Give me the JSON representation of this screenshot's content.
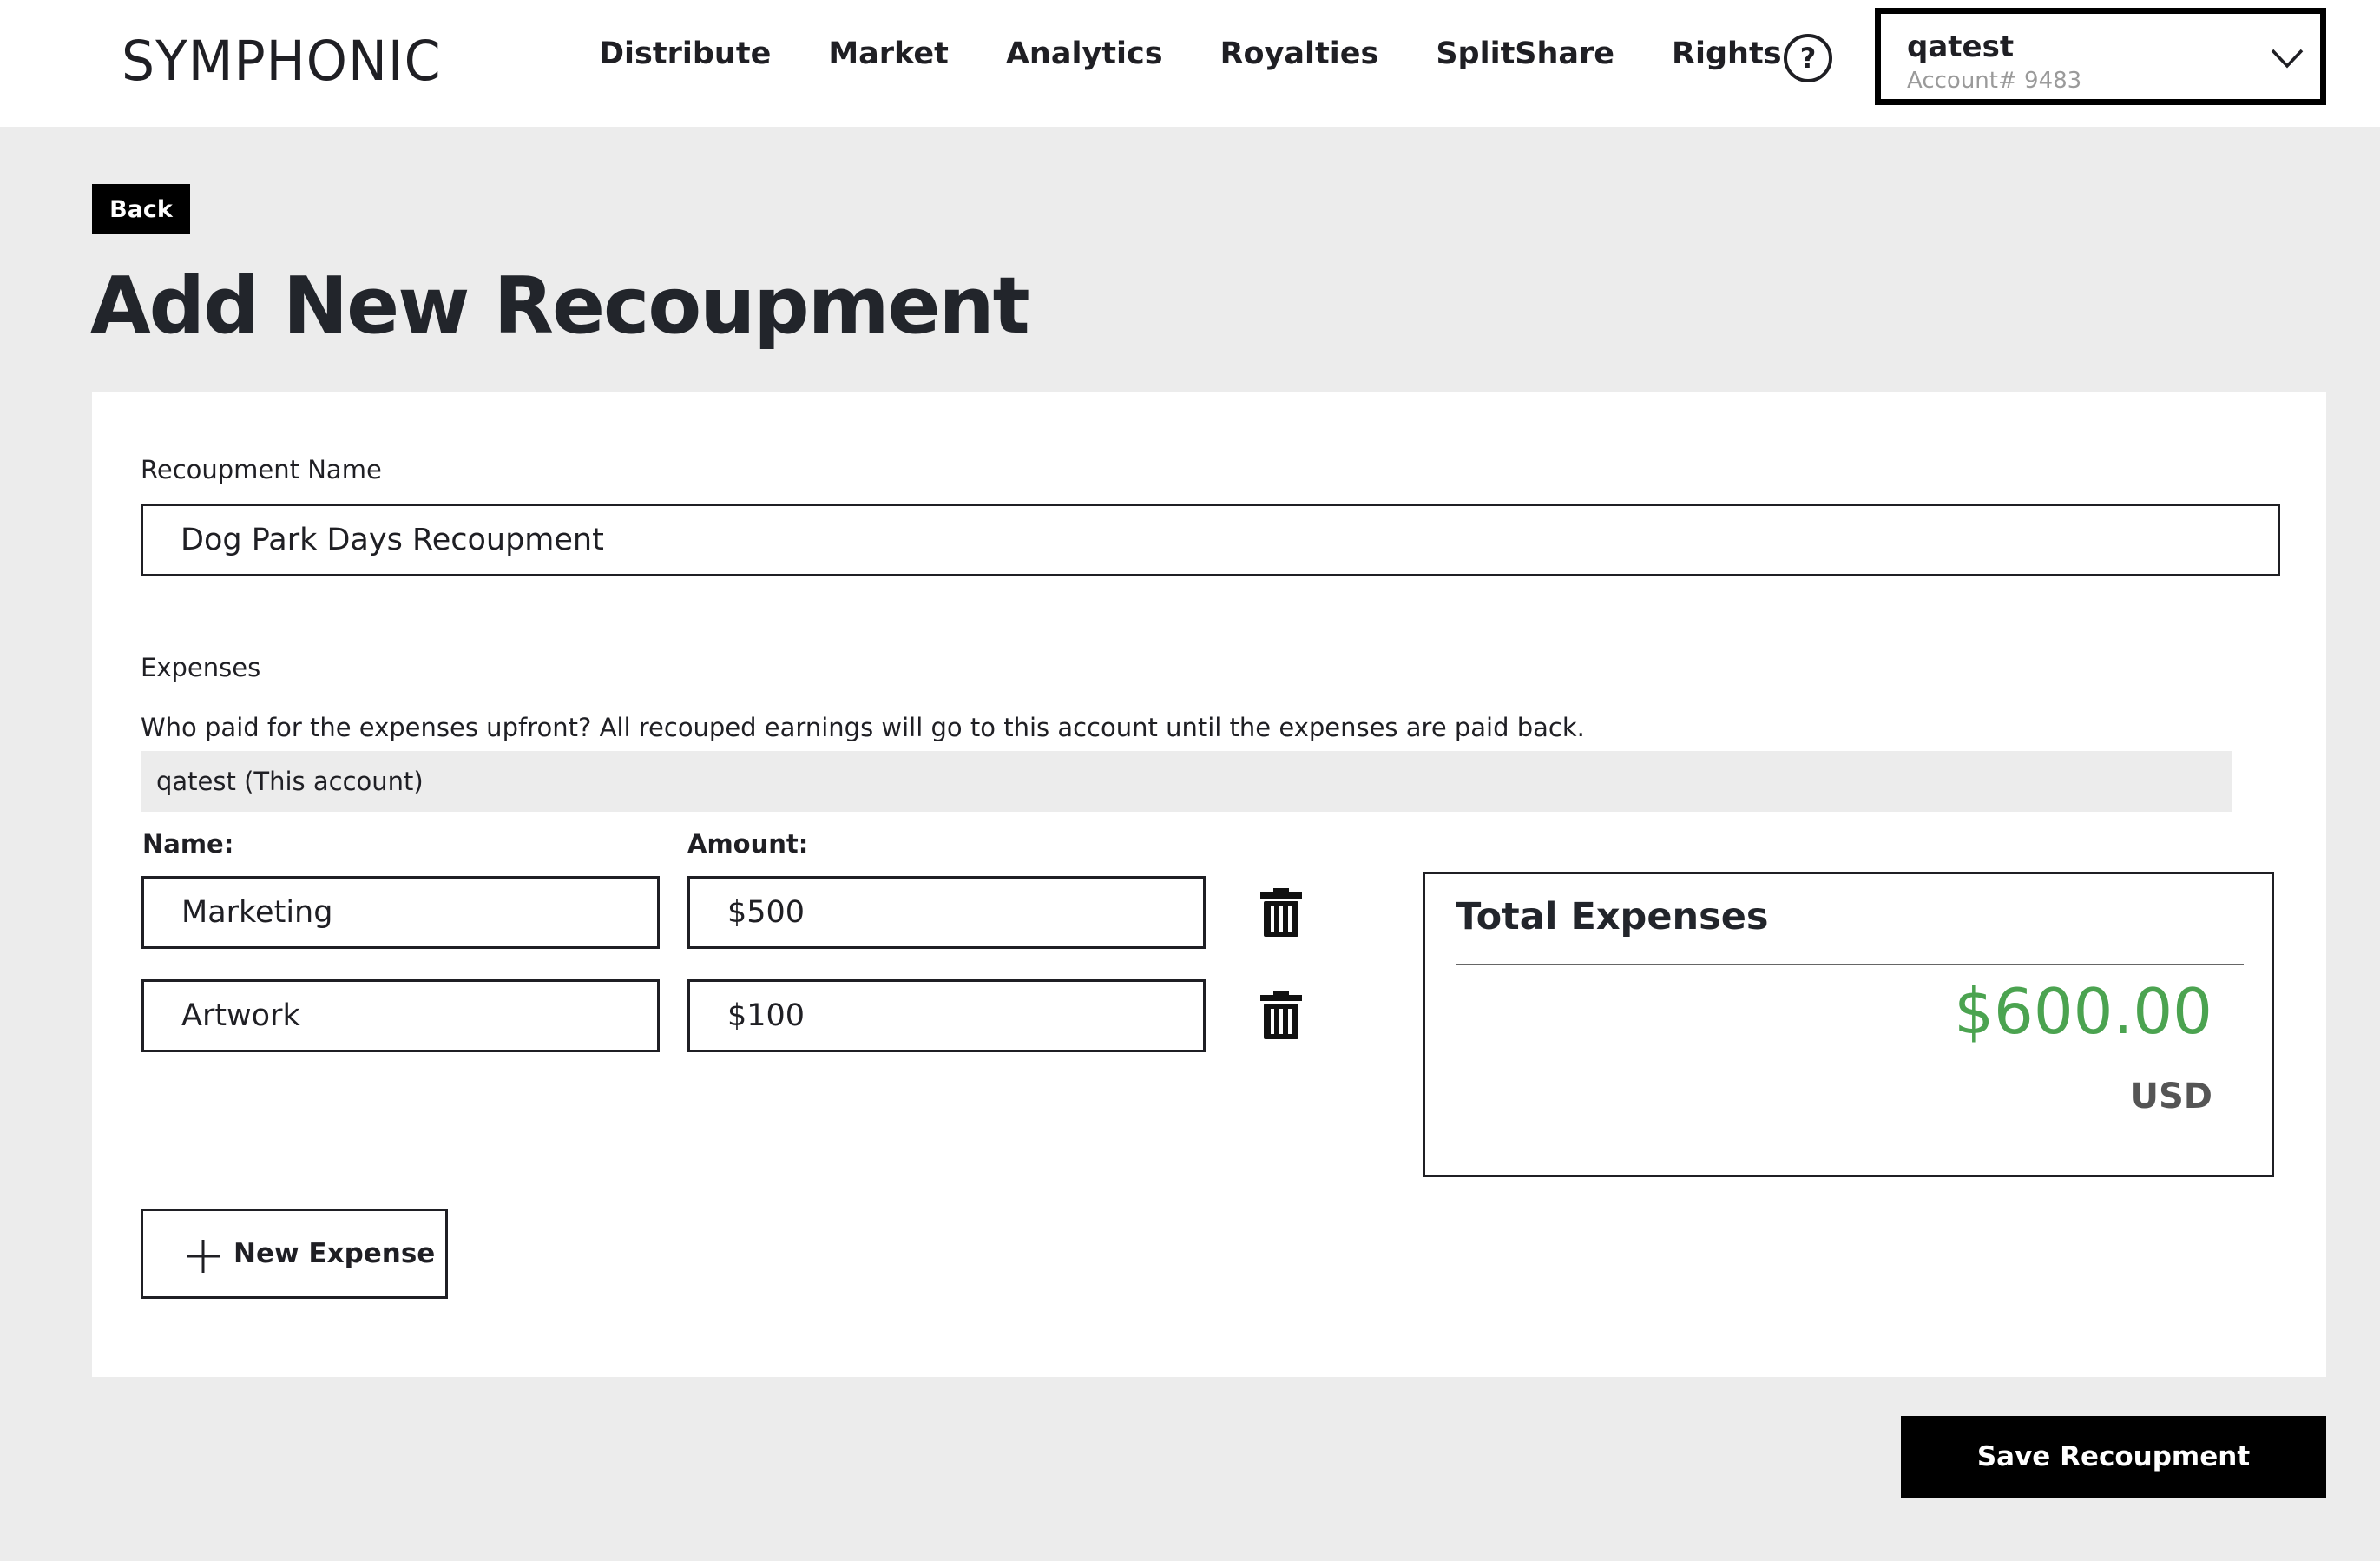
{
  "header": {
    "logo": "SYMPHONIC",
    "nav": [
      "Distribute",
      "Market",
      "Analytics",
      "Royalties",
      "SplitShare",
      "Rights"
    ],
    "help_icon": "question-circle-icon",
    "help_glyph": "?",
    "account": {
      "name": "qatest",
      "number": "Account# 9483"
    }
  },
  "page": {
    "back_label": "Back",
    "title": "Add New Recoupment"
  },
  "form": {
    "name_label": "Recoupment Name",
    "name_value": "Dog Park Days Recoupment",
    "expenses_label": "Expenses",
    "payer_question": "Who paid for the expenses upfront? All recouped earnings will go to this account until the expenses are paid back.",
    "payer_value": "qatest (This account)",
    "col_name": "Name:",
    "col_amount": "Amount:",
    "expenses": [
      {
        "name": "Marketing",
        "amount": "$500"
      },
      {
        "name": "Artwork",
        "amount": "$100"
      }
    ],
    "new_expense_label": "New Expense"
  },
  "total": {
    "title": "Total Expenses",
    "amount": "$600.00",
    "currency": "USD",
    "amount_color": "#4ba350"
  },
  "actions": {
    "save_label": "Save Recoupment"
  }
}
